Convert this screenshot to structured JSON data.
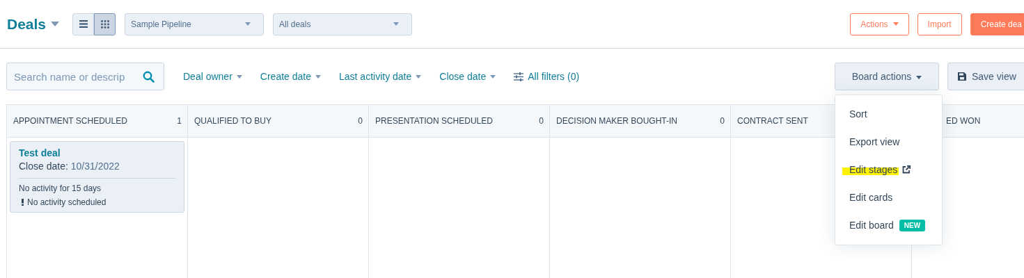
{
  "header": {
    "title": "Deals",
    "view_toggle": [
      {
        "kind": "list",
        "selected": false
      },
      {
        "kind": "board",
        "selected": true
      }
    ],
    "pipeline_select": "Sample Pipeline",
    "view_select": "All deals",
    "buttons": [
      {
        "label": "Actions",
        "kind": "menu"
      },
      {
        "label": "Import",
        "kind": "secondary"
      },
      {
        "label": "Create dea",
        "kind": "primary"
      }
    ]
  },
  "filter_bar": {
    "search": {
      "placeholder": "Search name or descrip"
    },
    "filters": [
      {
        "label": "Deal owner",
        "kind": "dropdown"
      },
      {
        "label": "Create date",
        "kind": "dropdown"
      },
      {
        "label": "Last activity date",
        "kind": "dropdown"
      },
      {
        "label": "Close date",
        "kind": "dropdown"
      },
      {
        "label": "All filters (0)",
        "kind": "all"
      }
    ],
    "board_actions": "Board actions",
    "save_view": "Save view"
  },
  "columns": [
    {
      "title": "APPOINTMENT SCHEDULED",
      "count": "1",
      "kind": "full",
      "deals": [
        {
          "name": "Test deal",
          "close_label": "Close date:",
          "close_date": "10/31/2022",
          "activity": "No activity for 15 days",
          "warning": "No activity scheduled"
        }
      ]
    },
    {
      "title": "QUALIFIED TO BUY",
      "count": "0",
      "kind": "full"
    },
    {
      "title": "PRESENTATION SCHEDULED",
      "count": "0",
      "kind": "full"
    },
    {
      "title": "DECISION MAKER BOUGHT-IN",
      "count": "0",
      "kind": "full"
    },
    {
      "title": "CONTRACT SENT",
      "kind": "full"
    },
    {
      "title": "ED WON",
      "kind": "covered"
    }
  ],
  "board_menu": {
    "items": [
      {
        "label": "Sort",
        "kind": "plain",
        "highlighted": false
      },
      {
        "label": "Export view",
        "kind": "plain",
        "highlighted": false
      },
      {
        "label": "Edit stages",
        "kind": "external",
        "highlighted": true
      },
      {
        "label": "Edit cards",
        "kind": "plain",
        "highlighted": false
      },
      {
        "label": "Edit board",
        "kind": "new",
        "badge": "NEW",
        "highlighted": false
      }
    ]
  }
}
